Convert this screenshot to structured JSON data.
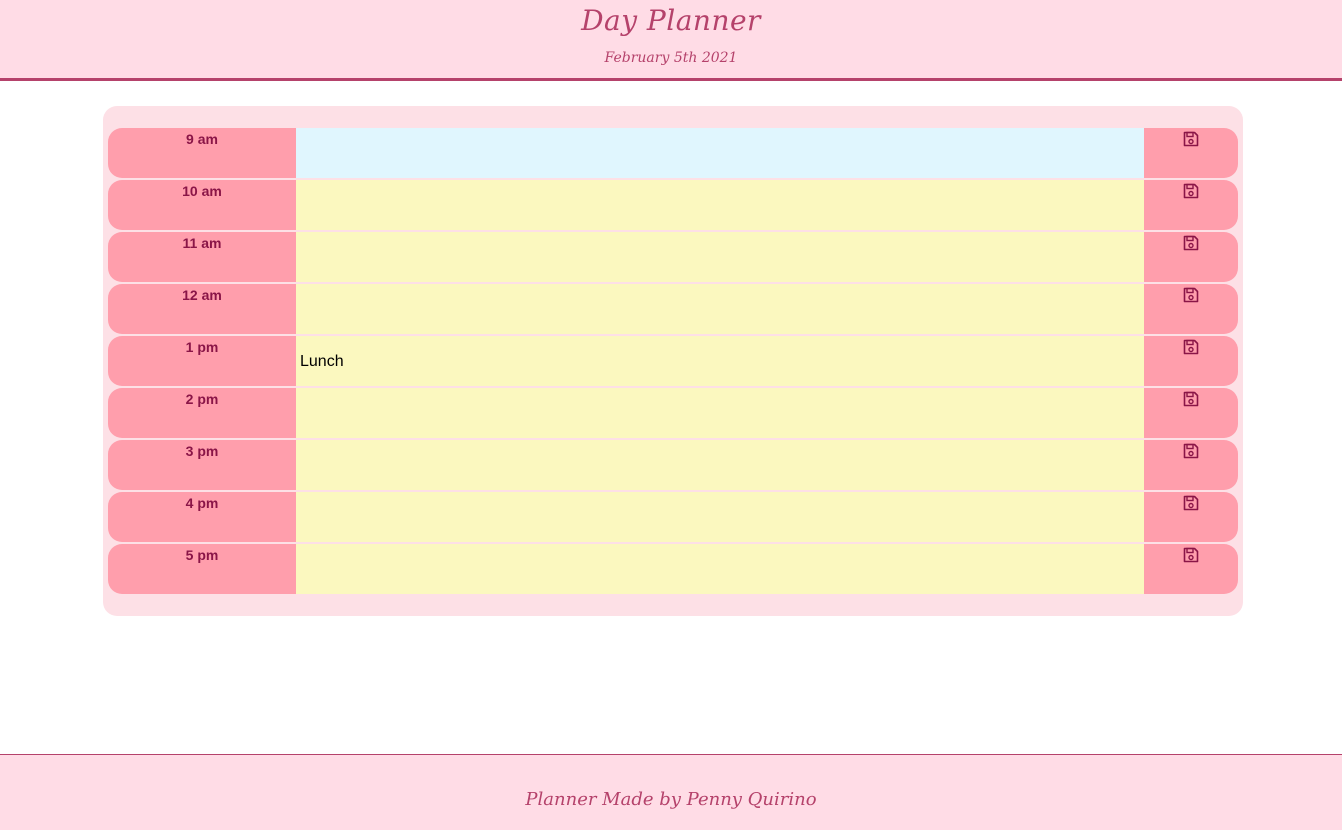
{
  "header": {
    "title": "Day Planner",
    "date": "February 5th 2021"
  },
  "rows": [
    {
      "hour": "9 am",
      "text": "",
      "state": "present"
    },
    {
      "hour": "10 am",
      "text": "",
      "state": "future"
    },
    {
      "hour": "11 am",
      "text": "",
      "state": "future"
    },
    {
      "hour": "12 am",
      "text": "",
      "state": "future"
    },
    {
      "hour": "1 pm",
      "text": "Lunch",
      "state": "future"
    },
    {
      "hour": "2 pm",
      "text": "",
      "state": "future"
    },
    {
      "hour": "3 pm",
      "text": "",
      "state": "future"
    },
    {
      "hour": "4 pm",
      "text": "",
      "state": "future"
    },
    {
      "hour": "5 pm",
      "text": "",
      "state": "future"
    }
  ],
  "footer": {
    "text": "Planner Made by Penny Quirino"
  },
  "icons": {
    "save": "floppy-disk-icon"
  },
  "colors": {
    "accent": "#b5426b",
    "hour_bg": "#ff9eac",
    "present": "#e0f6fe",
    "future": "#fbf8bf",
    "header_bg": "#ffdce6"
  }
}
